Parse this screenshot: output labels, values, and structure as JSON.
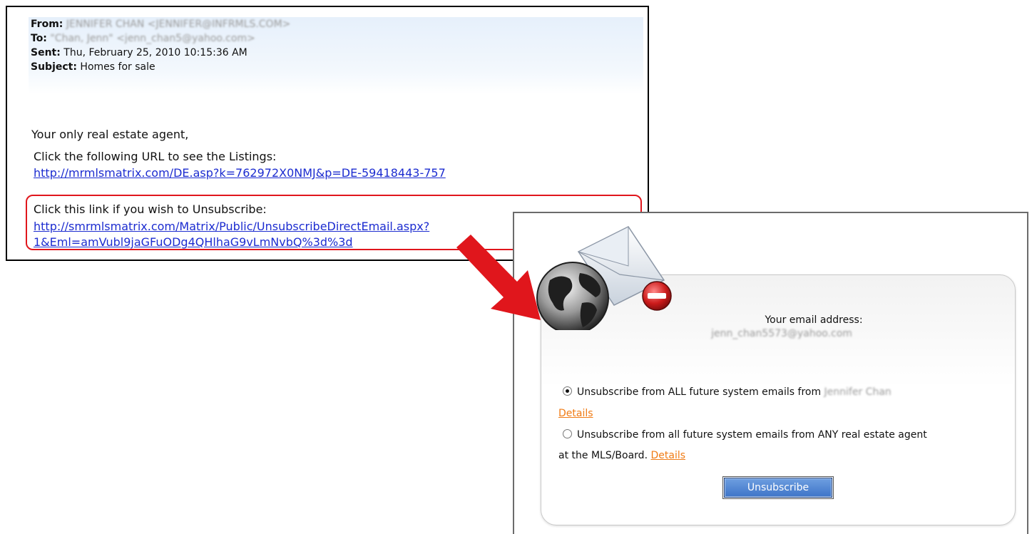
{
  "email": {
    "from_label": "From:",
    "from_value": "JENNIFER CHAN <JENNIFER@INFRMLS.COM>",
    "to_label": "To:",
    "to_value": "\"Chan, Jenn\" <jenn_chan5@yahoo.com>",
    "sent_label": "Sent:",
    "sent_value": "Thu, February 25, 2010 10:15:36 AM",
    "subject_label": "Subject:",
    "subject_value": "Homes for sale",
    "greeting": "Your only real estate agent,",
    "listings_label": "Click the following URL to see the Listings:",
    "listings_link": "http://mrmlsmatrix.com/DE.asp?k=762972X0NMJ&p=DE-59418443-757",
    "unsubscribe_label": "Click this link if you wish to Unsubscribe:",
    "unsubscribe_link_line1": "http://smrmlsmatrix.com/Matrix/Public/UnsubscribeDirectEmail.aspx?",
    "unsubscribe_link_line2": "1&Eml=amVubl9jaGFuODg4QHlhaG9vLmNvbQ%3d%3d"
  },
  "unsubscribe_page": {
    "email_label": "Your email address:",
    "email_value": "jenn_chan5573@yahoo.com",
    "option_all_label": "Unsubscribe from ALL future system emails from",
    "option_all_agent": "Jennifer Chan",
    "option_all_details": "Details",
    "option_any_label_line1": "Unsubscribe from all future system emails from ANY real estate agent",
    "option_any_label_line2": "at the MLS/Board.",
    "option_any_details": "Details",
    "unsubscribe_button": "Unsubscribe",
    "selected_option": "all"
  },
  "colors": {
    "link": "#1c2cd0",
    "highlight_box": "#e0161c",
    "arrow": "#e0161c",
    "details_link": "#f07b14",
    "button": "#3d74c8"
  }
}
